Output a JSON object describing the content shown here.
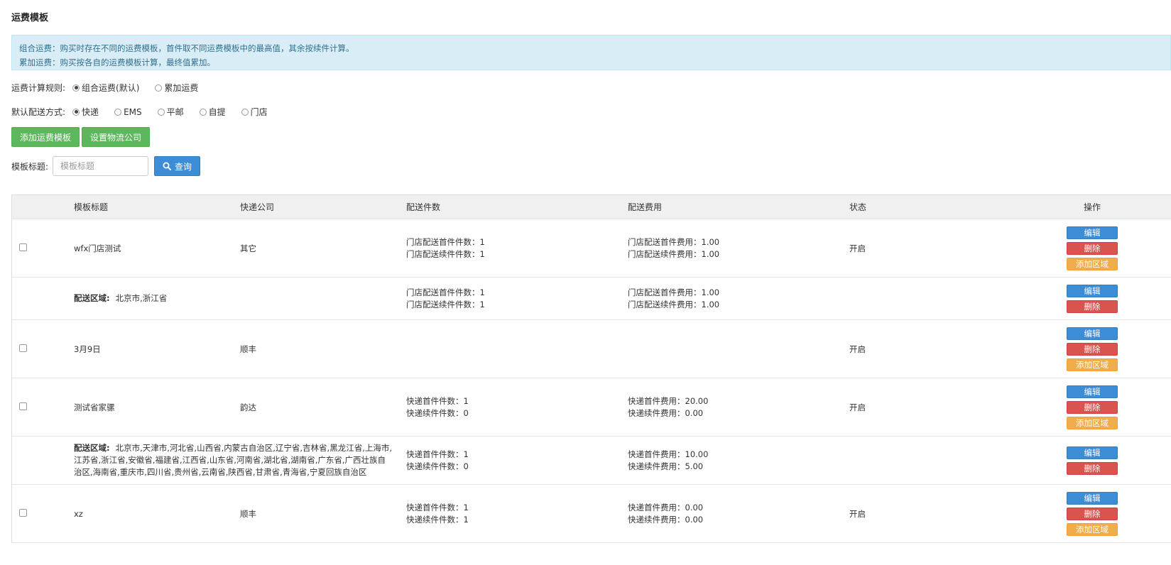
{
  "page": {
    "title": "运费模板"
  },
  "notice": {
    "line1": "组合运费：购买时存在不同的运费模板，首件取不同运费模板中的最高值，其余按续件计算。",
    "line2": "累加运费：购买按各自的运费模板计算，最终值累加。"
  },
  "calc_rule": {
    "label": "运费计算规则:",
    "options": [
      "组合运费(默认)",
      "累加运费"
    ],
    "selected": "组合运费(默认)"
  },
  "delivery": {
    "label": "默认配送方式:",
    "options": [
      "快递",
      "EMS",
      "平邮",
      "自提",
      "门店"
    ],
    "selected": "快递"
  },
  "actions": {
    "add_template": "添加运费模板",
    "set_logistics": "设置物流公司"
  },
  "search": {
    "label": "模板标题:",
    "placeholder": "模板标题",
    "button": "查询"
  },
  "table": {
    "headers": {
      "title": "模板标题",
      "company": "快递公司",
      "count": "配送件数",
      "fee": "配送费用",
      "status": "状态",
      "ops": "操作"
    },
    "op_labels": {
      "edit": "编辑",
      "delete": "删除",
      "add_area": "添加区域"
    },
    "area_label": "配送区域:",
    "rows": [
      {
        "type": "main",
        "title": "wfx门店测试",
        "company": "其它",
        "count1": "门店配送首件件数：1",
        "count2": "门店配送续件件数：1",
        "fee1": "门店配送首件费用：1.00",
        "fee2": "门店配送续件费用：1.00",
        "status": "开启"
      },
      {
        "type": "area",
        "area": "北京市,浙江省",
        "count1": "门店配送首件件数：1",
        "count2": "门店配送续件件数：1",
        "fee1": "门店配送首件费用：1.00",
        "fee2": "门店配送续件费用：1.00"
      },
      {
        "type": "main",
        "title": "3月9日",
        "company": "顺丰",
        "count1": "",
        "count2": "",
        "fee1": "",
        "fee2": "",
        "status": "开启"
      },
      {
        "type": "main",
        "title": "测试省家骡",
        "company": "韵达",
        "count1": "快递首件件数：1",
        "count2": "快递续件件数：0",
        "fee1": "快递首件费用：20.00",
        "fee2": "快递续件费用：0.00",
        "status": "开启"
      },
      {
        "type": "area",
        "area": "北京市,天津市,河北省,山西省,内蒙古自治区,辽宁省,吉林省,黑龙江省,上海市,江苏省,浙江省,安徽省,福建省,江西省,山东省,河南省,湖北省,湖南省,广东省,广西壮族自治区,海南省,重庆市,四川省,贵州省,云南省,陕西省,甘肃省,青海省,宁夏回族自治区",
        "count1": "快递首件件数：1",
        "count2": "快递续件件数：0",
        "fee1": "快递首件费用：10.00",
        "fee2": "快递续件费用：5.00"
      },
      {
        "type": "main",
        "title": "xz",
        "company": "顺丰",
        "count1": "快递首件件数：1",
        "count2": "快递续件件数：1",
        "fee1": "快递首件费用：0.00",
        "fee2": "快递续件费用：0.00",
        "status": "开启"
      }
    ]
  }
}
